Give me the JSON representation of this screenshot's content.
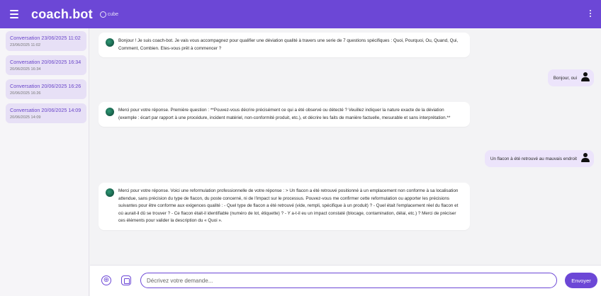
{
  "appbar": {
    "title": "coach.bot",
    "logo_text": "cube"
  },
  "sidebar": {
    "conversations": [
      {
        "title": "Conversation 23/06/2025 11:02",
        "date": "23/06/2025 11:02"
      },
      {
        "title": "Conversation 20/06/2025 16:34",
        "date": "20/06/2025 16:34"
      },
      {
        "title": "Conversation 20/06/2025 16:26",
        "date": "20/06/2025 16:26"
      },
      {
        "title": "Conversation 20/06/2025 14:09",
        "date": "20/06/2025 14:09"
      }
    ]
  },
  "messages": [
    {
      "role": "bot",
      "text": "Bonjour ! Je suis coach-bot. Je vais vous accompagnez pour qualifier une déviation qualité à travers une serie de 7 questions spécifiques : Quoi, Pourquoi, Ou, Quand, Qui, Comment, Combien. Etes-vous prêt à commencer ?"
    },
    {
      "role": "user",
      "text": "Bonjour, oui"
    },
    {
      "role": "bot",
      "text": "Merci pour votre réponse. Première question : **Pouvez-vous décrire précisément ce qui a été observé ou détecté ? Veuillez indiquer la nature exacte de la déviation (exemple : écart par rapport à une procédure, incident matériel, non-conformité produit, etc.), et décrire les faits de manière factuelle, mesurable et sans interprétation.**"
    },
    {
      "role": "user",
      "text": "Un flacon à été retrouvé au mauvais endroit"
    },
    {
      "role": "bot",
      "text": "Merci pour votre réponse. Voici une reformulation professionnelle de votre réponse : > Un flacon a été retrouvé positionné à un emplacement non conforme à sa localisation attendue, sans précision du type de flacon, du poste concerné, ni de l'impact sur le processus. Pouvez-vous me confirmer cette reformulation ou apporter les précisions suivantes pour être conforme aux exigences qualité : - Quel type de flacon a été retrouvé (vide, rempli, spécifique à un produit) ? - Quel était l'emplacement réel du flacon et où aurait-il dû se trouver ? - Ce flacon était-il identifiable (numéro de lot, étiquette) ? - Y a-t-il eu un impact constaté (blocage, contamination, délai, etc.) ? Merci de préciser ces éléments pour valider la description du « Quoi »."
    }
  ],
  "composer": {
    "add_symbol": "⊕",
    "placeholder": "Décrivez votre demande...",
    "value": "",
    "send_label": "Envoyer"
  }
}
